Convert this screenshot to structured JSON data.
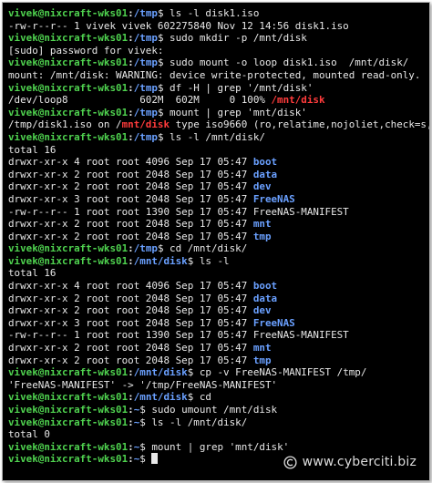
{
  "terminal": {
    "colors": {
      "background": "#000000",
      "text": "#e8e8e8",
      "user": "#4fd24f",
      "path": "#6aa0ff",
      "directory": "#6aa0ff",
      "grep_match": "#ff3b3b"
    },
    "lines": [
      [
        {
          "t": "vivek@nixcraft-wks01",
          "c": "user"
        },
        {
          "t": ":",
          "c": "colon"
        },
        {
          "t": "/tmp",
          "c": "path"
        },
        {
          "t": "$ ls -l disk1.iso",
          "c": "text"
        }
      ],
      [
        {
          "t": "-rw-r--r-- 1 vivek vivek 602275840 Nov 12 14:56 disk1.iso",
          "c": "text"
        }
      ],
      [
        {
          "t": "vivek@nixcraft-wks01",
          "c": "user"
        },
        {
          "t": ":",
          "c": "colon"
        },
        {
          "t": "/tmp",
          "c": "path"
        },
        {
          "t": "$ sudo mkdir -p /mnt/disk",
          "c": "text"
        }
      ],
      [
        {
          "t": "[sudo] password for vivek:",
          "c": "text"
        }
      ],
      [
        {
          "t": "vivek@nixcraft-wks01",
          "c": "user"
        },
        {
          "t": ":",
          "c": "colon"
        },
        {
          "t": "/tmp",
          "c": "path"
        },
        {
          "t": "$ sudo mount -o loop disk1.iso  /mnt/disk/",
          "c": "text"
        }
      ],
      [
        {
          "t": "mount: /mnt/disk: WARNING: device write-protected, mounted read-only.",
          "c": "text"
        }
      ],
      [
        {
          "t": "vivek@nixcraft-wks01",
          "c": "user"
        },
        {
          "t": ":",
          "c": "colon"
        },
        {
          "t": "/tmp",
          "c": "path"
        },
        {
          "t": "$ df -H | grep '/mnt/disk'",
          "c": "text"
        }
      ],
      [
        {
          "t": "/dev/loop8            602M  602M     0 100% ",
          "c": "text"
        },
        {
          "t": "/mnt/disk",
          "c": "match"
        }
      ],
      [
        {
          "t": "vivek@nixcraft-wks01",
          "c": "user"
        },
        {
          "t": ":",
          "c": "colon"
        },
        {
          "t": "/tmp",
          "c": "path"
        },
        {
          "t": "$ mount | grep 'mnt/disk'",
          "c": "text"
        }
      ],
      [
        {
          "t": "/tmp/disk1.iso on /",
          "c": "text"
        },
        {
          "t": "mnt/disk",
          "c": "match"
        },
        {
          "t": " type iso9660 (ro,relatime,nojoliet,check=s,ma",
          "c": "text"
        }
      ],
      [
        {
          "t": "vivek@nixcraft-wks01",
          "c": "user"
        },
        {
          "t": ":",
          "c": "colon"
        },
        {
          "t": "/tmp",
          "c": "path"
        },
        {
          "t": "$ ls -l /mnt/disk/",
          "c": "text"
        }
      ],
      [
        {
          "t": "total 16",
          "c": "text"
        }
      ],
      [
        {
          "t": "drwxr-xr-x 4 root root 4096 Sep 17 05:47 ",
          "c": "text"
        },
        {
          "t": "boot",
          "c": "dir"
        }
      ],
      [
        {
          "t": "drwxr-xr-x 2 root root 2048 Sep 17 05:47 ",
          "c": "text"
        },
        {
          "t": "data",
          "c": "dir"
        }
      ],
      [
        {
          "t": "drwxr-xr-x 2 root root 2048 Sep 17 05:47 ",
          "c": "text"
        },
        {
          "t": "dev",
          "c": "dir"
        }
      ],
      [
        {
          "t": "drwxr-xr-x 3 root root 2048 Sep 17 05:47 ",
          "c": "text"
        },
        {
          "t": "FreeNAS",
          "c": "dir"
        }
      ],
      [
        {
          "t": "-rw-r--r-- 1 root root 1390 Sep 17 05:47 FreeNAS-MANIFEST",
          "c": "text"
        }
      ],
      [
        {
          "t": "drwxr-xr-x 2 root root 2048 Sep 17 05:47 ",
          "c": "text"
        },
        {
          "t": "mnt",
          "c": "dir"
        }
      ],
      [
        {
          "t": "drwxr-xr-x 2 root root 2048 Sep 17 05:47 ",
          "c": "text"
        },
        {
          "t": "tmp",
          "c": "dir"
        }
      ],
      [
        {
          "t": "vivek@nixcraft-wks01",
          "c": "user"
        },
        {
          "t": ":",
          "c": "colon"
        },
        {
          "t": "/tmp",
          "c": "path"
        },
        {
          "t": "$ cd /mnt/disk/",
          "c": "text"
        }
      ],
      [
        {
          "t": "vivek@nixcraft-wks01",
          "c": "user"
        },
        {
          "t": ":",
          "c": "colon"
        },
        {
          "t": "/mnt/disk",
          "c": "path"
        },
        {
          "t": "$ ls -l",
          "c": "text"
        }
      ],
      [
        {
          "t": "total 16",
          "c": "text"
        }
      ],
      [
        {
          "t": "drwxr-xr-x 4 root root 4096 Sep 17 05:47 ",
          "c": "text"
        },
        {
          "t": "boot",
          "c": "dir"
        }
      ],
      [
        {
          "t": "drwxr-xr-x 2 root root 2048 Sep 17 05:47 ",
          "c": "text"
        },
        {
          "t": "data",
          "c": "dir"
        }
      ],
      [
        {
          "t": "drwxr-xr-x 2 root root 2048 Sep 17 05:47 ",
          "c": "text"
        },
        {
          "t": "dev",
          "c": "dir"
        }
      ],
      [
        {
          "t": "drwxr-xr-x 3 root root 2048 Sep 17 05:47 ",
          "c": "text"
        },
        {
          "t": "FreeNAS",
          "c": "dir"
        }
      ],
      [
        {
          "t": "-rw-r--r-- 1 root root 1390 Sep 17 05:47 FreeNAS-MANIFEST",
          "c": "text"
        }
      ],
      [
        {
          "t": "drwxr-xr-x 2 root root 2048 Sep 17 05:47 ",
          "c": "text"
        },
        {
          "t": "mnt",
          "c": "dir"
        }
      ],
      [
        {
          "t": "drwxr-xr-x 2 root root 2048 Sep 17 05:47 ",
          "c": "text"
        },
        {
          "t": "tmp",
          "c": "dir"
        }
      ],
      [
        {
          "t": "vivek@nixcraft-wks01",
          "c": "user"
        },
        {
          "t": ":",
          "c": "colon"
        },
        {
          "t": "/mnt/disk",
          "c": "path"
        },
        {
          "t": "$ cp -v FreeNAS-MANIFEST /tmp/",
          "c": "text"
        }
      ],
      [
        {
          "t": "'FreeNAS-MANIFEST' -> '/tmp/FreeNAS-MANIFEST'",
          "c": "text"
        }
      ],
      [
        {
          "t": "vivek@nixcraft-wks01",
          "c": "user"
        },
        {
          "t": ":",
          "c": "colon"
        },
        {
          "t": "/mnt/disk",
          "c": "path"
        },
        {
          "t": "$ cd",
          "c": "text"
        }
      ],
      [
        {
          "t": "vivek@nixcraft-wks01",
          "c": "user"
        },
        {
          "t": ":",
          "c": "colon"
        },
        {
          "t": "~",
          "c": "path"
        },
        {
          "t": "$ sudo umount /mnt/disk",
          "c": "text"
        }
      ],
      [
        {
          "t": "vivek@nixcraft-wks01",
          "c": "user"
        },
        {
          "t": ":",
          "c": "colon"
        },
        {
          "t": "~",
          "c": "path"
        },
        {
          "t": "$ ls -l /mnt/disk/",
          "c": "text"
        }
      ],
      [
        {
          "t": "total 0",
          "c": "text"
        }
      ],
      [
        {
          "t": "vivek@nixcraft-wks01",
          "c": "user"
        },
        {
          "t": ":",
          "c": "colon"
        },
        {
          "t": "~",
          "c": "path"
        },
        {
          "t": "$ mount | grep 'mnt/disk'",
          "c": "text"
        }
      ],
      [
        {
          "t": "vivek@nixcraft-wks01",
          "c": "user"
        },
        {
          "t": ":",
          "c": "colon"
        },
        {
          "t": "~",
          "c": "path"
        },
        {
          "t": "$ ",
          "c": "text"
        },
        {
          "t": "",
          "c": "cursor"
        }
      ]
    ]
  },
  "watermark": {
    "icon": "copyright-c-icon",
    "text": "www.cyberciti.biz"
  }
}
